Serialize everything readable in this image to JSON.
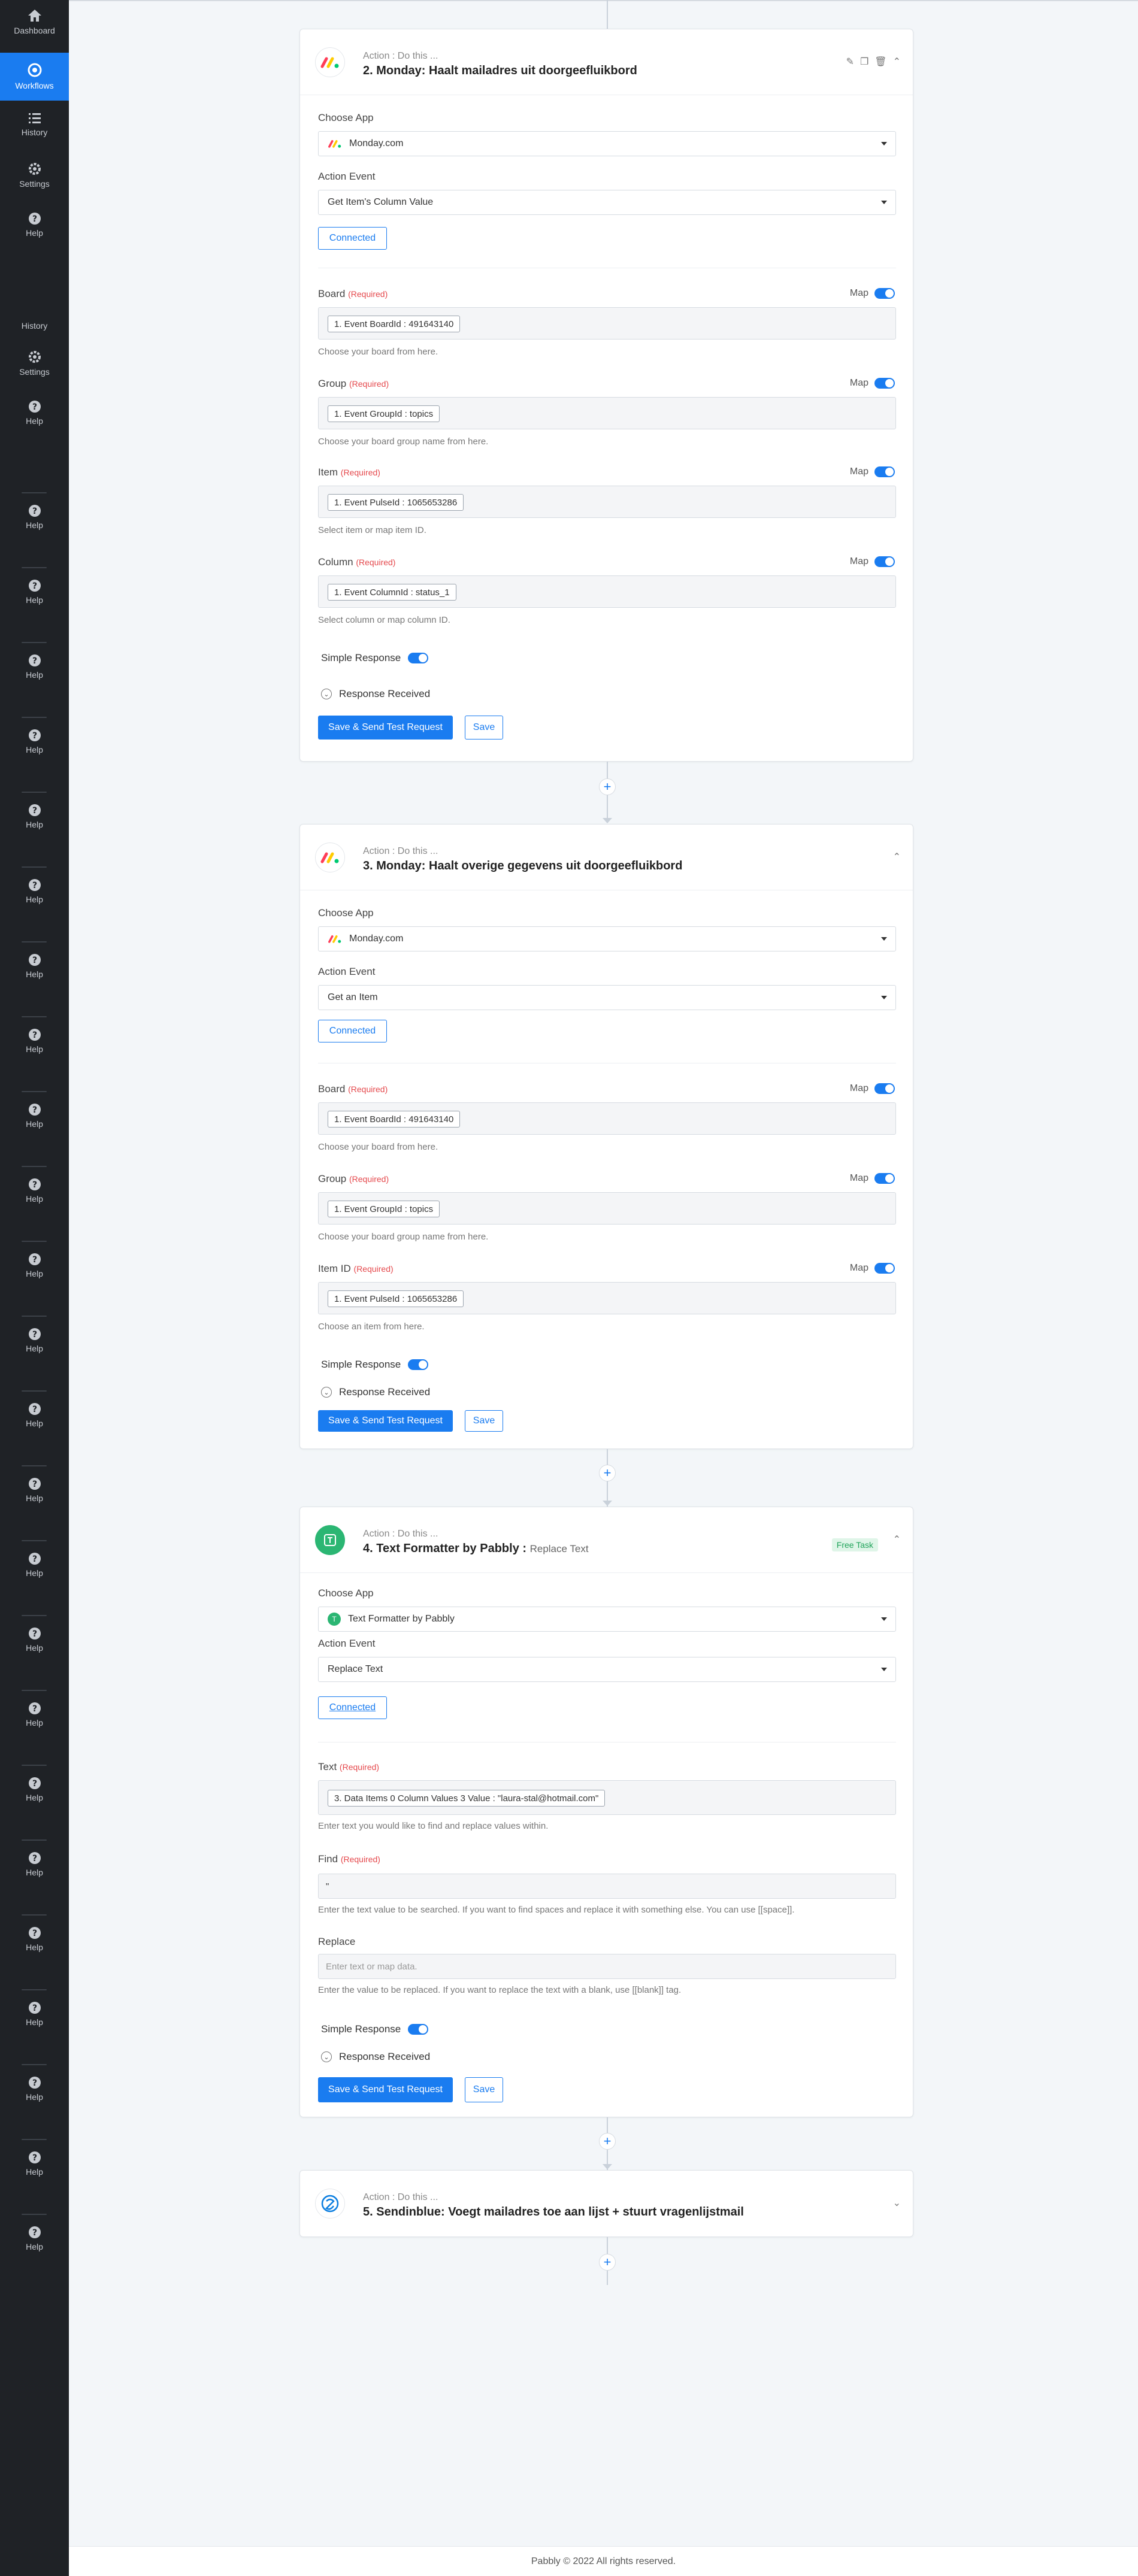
{
  "sidebar": {
    "dashboard": "Dashboard",
    "workflows": "Workflows",
    "history": "History",
    "settings": "Settings",
    "help": "Help"
  },
  "steps": {
    "step2": {
      "subtitle": "Action : Do this ...",
      "title": "2. Monday: Haalt mailadres uit doorgeefluikbord",
      "choose_app_label": "Choose App",
      "app_value": "Monday.com",
      "action_event_label": "Action Event",
      "action_event_value": "Get Item's Column Value",
      "connected_label": "Connected",
      "fields": [
        {
          "label": "Board",
          "req": "(Required)",
          "map": "Map",
          "chip": "1. Event BoardId : 491643140",
          "help": "Choose your board from here."
        },
        {
          "label": "Group",
          "req": "(Required)",
          "map": "Map",
          "chip": "1. Event GroupId : topics",
          "help": "Choose your board group name from here."
        },
        {
          "label": "Item",
          "req": "(Required)",
          "map": "Map",
          "chip": "1. Event PulseId : 1065653286",
          "help": "Select item or map item ID."
        },
        {
          "label": "Column",
          "req": "(Required)",
          "map": "Map",
          "chip": "1. Event ColumnId : status_1",
          "help": "Select column or map column ID."
        }
      ],
      "simple_response": "Simple Response",
      "response_received": "Response Received",
      "send_label": "Save & Send Test Request",
      "save_label": "Save"
    },
    "step3": {
      "subtitle": "Action : Do this ...",
      "title": "3. Monday: Haalt overige gegevens uit doorgeefluikbord",
      "choose_app_label": "Choose App",
      "app_value": "Monday.com",
      "action_event_label": "Action Event",
      "action_event_value": "Get an Item",
      "connected_label": "Connected",
      "fields": [
        {
          "label": "Board",
          "req": "(Required)",
          "map": "Map",
          "chip": "1. Event BoardId : 491643140",
          "help": "Choose your board from here."
        },
        {
          "label": "Group",
          "req": "(Required)",
          "map": "Map",
          "chip": "1. Event GroupId : topics",
          "help": "Choose your board group name from here."
        },
        {
          "label": "Item ID",
          "req": "(Required)",
          "map": "Map",
          "chip": "1. Event PulseId : 1065653286",
          "help": "Choose an item from here."
        }
      ],
      "simple_response": "Simple Response",
      "response_received": "Response Received",
      "send_label": "Save & Send Test Request",
      "save_label": "Save"
    },
    "step4": {
      "subtitle": "Action : Do this ...",
      "title": "4. Text Formatter by Pabbly :",
      "title_light": "Replace Text",
      "badge": "Free Task",
      "choose_app_label": "Choose App",
      "app_value": "Text Formatter by Pabbly",
      "action_event_label": "Action Event",
      "action_event_value": "Replace Text",
      "connected_label": "Connected",
      "text_label": "Text",
      "text_req": "(Required)",
      "text_chip": "3. Data Items 0 Column Values 3 Value : \"laura-stal@hotmail.com\"",
      "text_help": "Enter text you would like to find and replace values within.",
      "find_label": "Find",
      "find_req": "(Required)",
      "find_value": "\"",
      "find_help": "Enter the text value to be searched. If you want to find spaces and replace it with something else. You can use [[space]].",
      "replace_label": "Replace",
      "replace_placeholder": "Enter text or map data.",
      "replace_help": "Enter the value to be replaced. If you want to replace the text with a blank, use [[blank]] tag.",
      "simple_response": "Simple Response",
      "response_received": "Response Received",
      "send_label": "Save & Send Test Request",
      "save_label": "Save"
    },
    "step5": {
      "subtitle": "Action : Do this ...",
      "title": "5. Sendinblue: Voegt mailadres toe aan lijst + stuurt vragenlijstmail"
    }
  },
  "footer": "Pabbly © 2022 All rights reserved.",
  "colors": {
    "sidebar_bg": "#1f2226",
    "accent": "#1a7cf0",
    "required": "#e5494d",
    "free_badge": "#20a35a"
  }
}
